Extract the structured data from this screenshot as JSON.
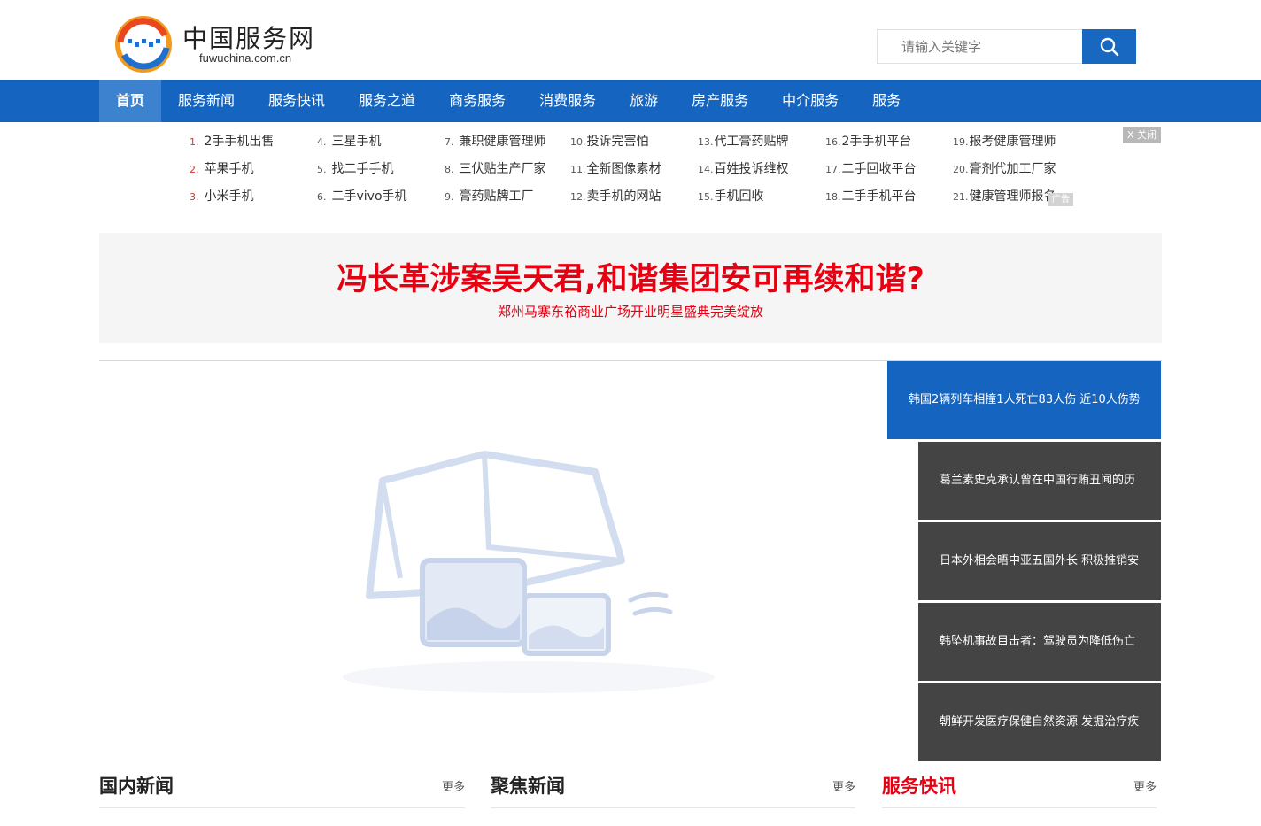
{
  "header": {
    "site_name_cn": "中国服务网",
    "site_domain": "fuwuchina.com.cn",
    "search": {
      "placeholder": "请输入关键字"
    }
  },
  "nav": {
    "items": [
      {
        "label": "首页",
        "active": true
      },
      {
        "label": "服务新闻"
      },
      {
        "label": "服务快讯"
      },
      {
        "label": "服务之道"
      },
      {
        "label": "商务服务"
      },
      {
        "label": "消费服务"
      },
      {
        "label": "旅游"
      },
      {
        "label": "房产服务"
      },
      {
        "label": "中介服务"
      },
      {
        "label": "服务"
      }
    ]
  },
  "keywords": {
    "close_label": "X 关闭",
    "ad_label": "广告",
    "items": [
      {
        "num": "1.",
        "text": "2手手机出售"
      },
      {
        "num": "2.",
        "text": "苹果手机"
      },
      {
        "num": "3.",
        "text": "小米手机"
      },
      {
        "num": "4.",
        "text": "三星手机"
      },
      {
        "num": "5.",
        "text": "找二手手机"
      },
      {
        "num": "6.",
        "text": "二手vivo手机"
      },
      {
        "num": "7.",
        "text": "兼职健康管理师"
      },
      {
        "num": "8.",
        "text": "三伏贴生产厂家"
      },
      {
        "num": "9.",
        "text": "膏药贴牌工厂"
      },
      {
        "num": "10.",
        "text": "投诉完害怕"
      },
      {
        "num": "11.",
        "text": "全新图像素材"
      },
      {
        "num": "12.",
        "text": "卖手机的网站"
      },
      {
        "num": "13.",
        "text": "代工膏药贴牌"
      },
      {
        "num": "14.",
        "text": "百姓投诉维权"
      },
      {
        "num": "15.",
        "text": "手机回收"
      },
      {
        "num": "16.",
        "text": "2手手机平台"
      },
      {
        "num": "17.",
        "text": "二手回收平台"
      },
      {
        "num": "18.",
        "text": "二手手机平台"
      },
      {
        "num": "19.",
        "text": "报考健康管理师"
      },
      {
        "num": "20.",
        "text": "膏剂代加工厂家"
      },
      {
        "num": "21.",
        "text": "健康管理师报名"
      }
    ]
  },
  "headline": {
    "title": "冯长革涉案吴天君,和谐集团安可再续和谐?",
    "subtitle": "郑州马寨东裕商业广场开业明星盛典完美绽放"
  },
  "slider": {
    "tabs": [
      "韩国2辆列车相撞1人死亡83人伤 近10人伤势",
      "葛兰素史克承认曾在中国行贿丑闻的历",
      "日本外相会晤中亚五国外长 积极推销安",
      "韩坠机事故目击者：驾驶员为降低伤亡",
      "朝鲜开发医疗保健自然资源 发掘治疗疾"
    ]
  },
  "sections": [
    {
      "title": "国内新闻",
      "more": "更多"
    },
    {
      "title": "聚焦新闻",
      "more": "更多"
    },
    {
      "title": "服务快讯",
      "more": "更多"
    }
  ],
  "colors": {
    "nav_bg": "#1565c0",
    "nav_active": "#3c82cf",
    "headline_red": "#e60012",
    "tab_dark": "#444444"
  }
}
